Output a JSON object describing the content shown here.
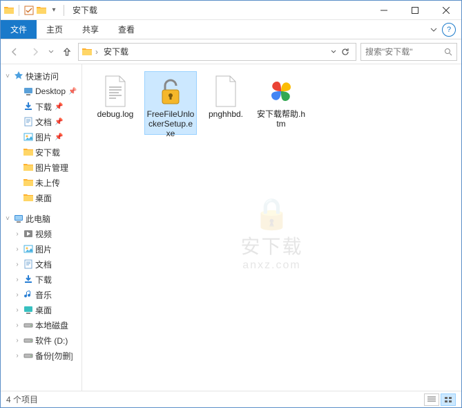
{
  "titlebar": {
    "title": "安下载",
    "dropdown_visible": true
  },
  "ribbon": {
    "file": "文件",
    "tabs": [
      "主页",
      "共享",
      "查看"
    ]
  },
  "address": {
    "crumb": "安下载"
  },
  "search": {
    "placeholder": "搜索\"安下载\""
  },
  "sidebar": {
    "quick_access": "快速访问",
    "quick_items": [
      {
        "label": "Desktop",
        "pin": true,
        "icon": "desktop"
      },
      {
        "label": "下载",
        "pin": true,
        "icon": "download"
      },
      {
        "label": "文档",
        "pin": true,
        "icon": "doc"
      },
      {
        "label": "图片",
        "pin": true,
        "icon": "pic"
      },
      {
        "label": "安下载",
        "pin": false,
        "icon": "folder"
      },
      {
        "label": "图片管理",
        "pin": false,
        "icon": "folder"
      },
      {
        "label": "未上传",
        "pin": false,
        "icon": "folder"
      },
      {
        "label": "桌面",
        "pin": false,
        "icon": "folder"
      }
    ],
    "this_pc": "此电脑",
    "pc_items": [
      {
        "label": "视频",
        "icon": "video"
      },
      {
        "label": "图片",
        "icon": "pic"
      },
      {
        "label": "文档",
        "icon": "doc"
      },
      {
        "label": "下载",
        "icon": "download"
      },
      {
        "label": "音乐",
        "icon": "music"
      },
      {
        "label": "桌面",
        "icon": "desktop2"
      },
      {
        "label": "本地磁盘",
        "icon": "drive"
      },
      {
        "label": "软件 (D:)",
        "icon": "drive"
      },
      {
        "label": "备份[勿删]",
        "icon": "drive"
      }
    ]
  },
  "files": [
    {
      "name": "debug.log",
      "type": "txt",
      "selected": false
    },
    {
      "name": "FreeFileUnlockerSetup.exe",
      "type": "lock",
      "selected": true
    },
    {
      "name": "pnghhbd.",
      "type": "blank",
      "selected": false
    },
    {
      "name": "安下载帮助.htm",
      "type": "pinwheel",
      "selected": false
    }
  ],
  "watermark": {
    "text": "安下载",
    "sub": "anxz.com"
  },
  "status": {
    "count": "4 个项目"
  }
}
